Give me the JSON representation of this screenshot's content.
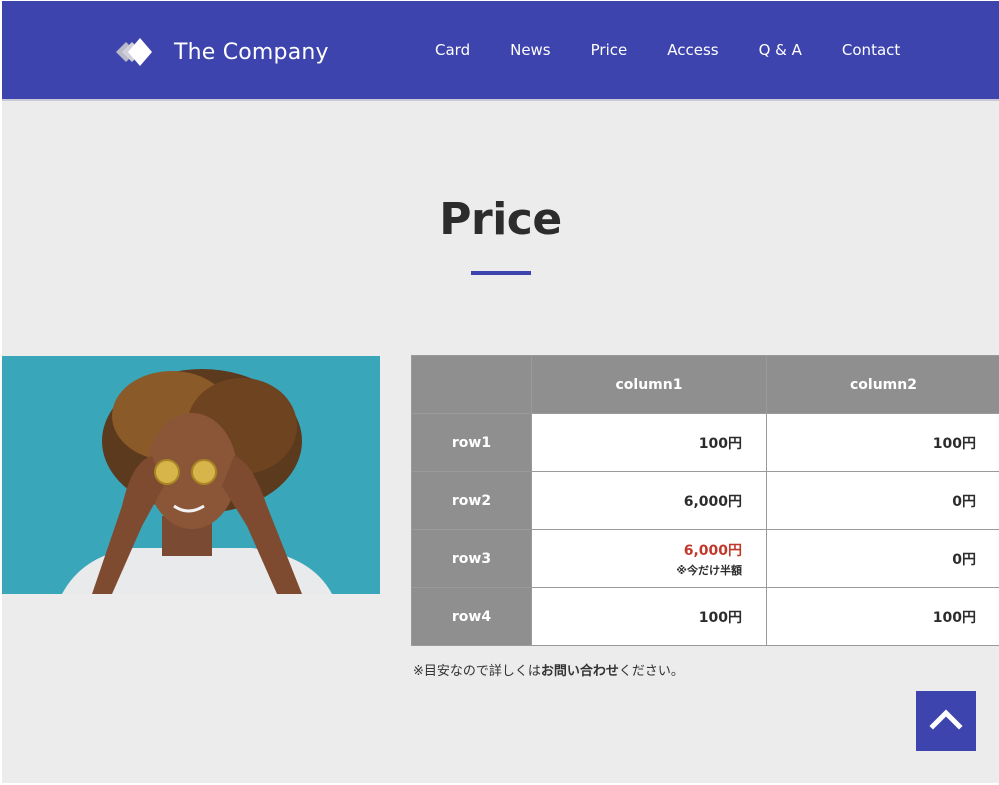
{
  "header": {
    "logo_text": "The Company",
    "nav": [
      "Card",
      "News",
      "Price",
      "Access",
      "Q & A",
      "Contact"
    ]
  },
  "page": {
    "title": "Price"
  },
  "table": {
    "headers": [
      "",
      "column1",
      "column2"
    ],
    "rows": [
      {
        "label": "row1",
        "col1": "100円",
        "col2": "100円"
      },
      {
        "label": "row2",
        "col1": "6,000円",
        "col2": "0円"
      },
      {
        "label": "row3",
        "col1": "6,000円",
        "col1_note": "※今だけ半額",
        "col2": "0円"
      },
      {
        "label": "row4",
        "col1": "100円",
        "col2": "100円"
      }
    ]
  },
  "footnote": {
    "prefix": "※目安なので詳しくは",
    "link": "お問い合わせ",
    "suffix": "ください。"
  },
  "colors": {
    "brand": "#3e44ad",
    "table_header": "#8f8f8f",
    "highlight": "#c0392b",
    "background": "#ececec"
  },
  "icons": {
    "logo": "diamond-logo-icon",
    "back_to_top": "chevron-up-icon"
  }
}
